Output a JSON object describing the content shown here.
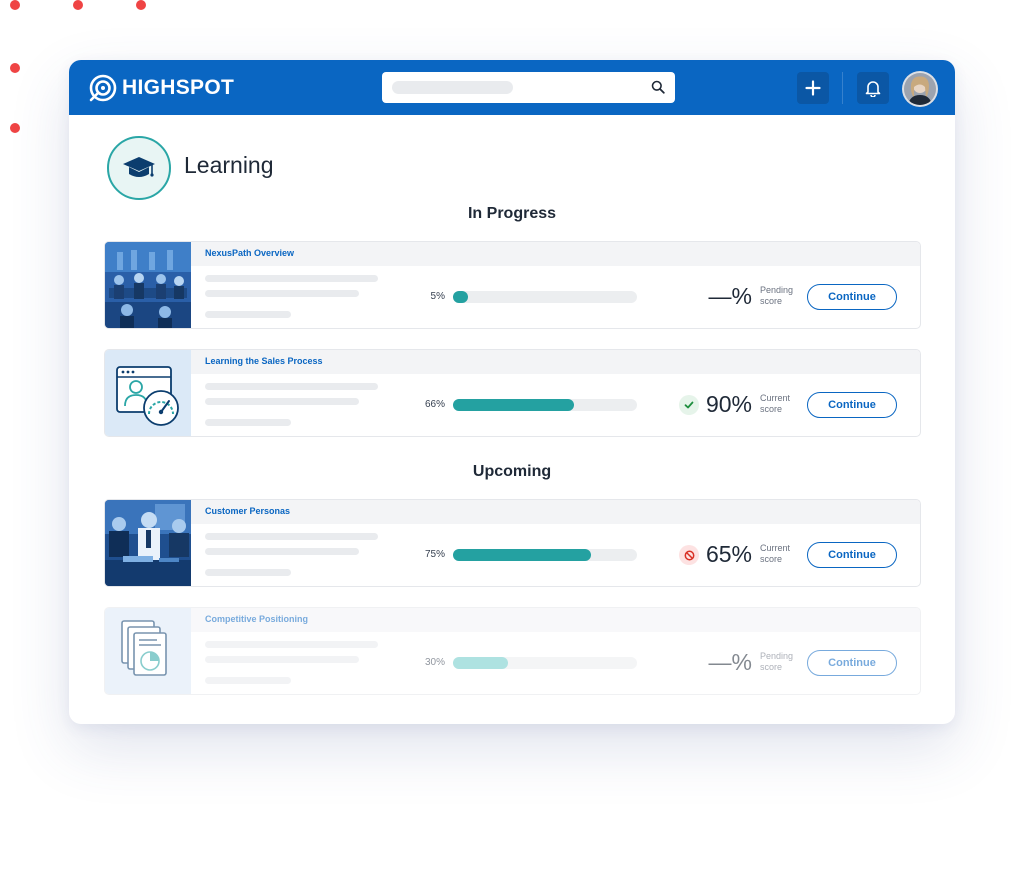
{
  "app": {
    "name": "HIGHSPOT"
  },
  "search": {
    "placeholder": ""
  },
  "page": {
    "title": "Learning"
  },
  "sections": {
    "in_progress": "In Progress",
    "upcoming": "Upcoming"
  },
  "courses": [
    {
      "title": "NexusPath Overview",
      "progress": 5,
      "progress_label": "5%",
      "score": "—%",
      "score_label_1": "Pending",
      "score_label_2": "score",
      "status": "none",
      "action": "Continue"
    },
    {
      "title": "Learning the Sales Process",
      "progress": 66,
      "progress_label": "66%",
      "score": "90%",
      "score_label_1": "Current",
      "score_label_2": "score",
      "status": "pass",
      "action": "Continue"
    },
    {
      "title": "Customer Personas",
      "progress": 75,
      "progress_label": "75%",
      "score": "65%",
      "score_label_1": "Current",
      "score_label_2": "score",
      "status": "fail",
      "action": "Continue"
    },
    {
      "title": "Competitive Positioning",
      "progress": 30,
      "progress_label": "30%",
      "score": "—%",
      "score_label_1": "Pending",
      "score_label_2": "score",
      "status": "none",
      "action": "Continue"
    }
  ],
  "icons": {
    "logo": "highspot-logo-icon",
    "search": "search-icon",
    "add": "plus-icon",
    "notifications": "bell-icon",
    "page": "graduation-cap-icon"
  },
  "colors": {
    "brand": "#0a66c2",
    "progress": "#24a1a1",
    "accent_dot": "#ef4444",
    "pass": "#1e8e3e",
    "fail": "#d93025"
  }
}
